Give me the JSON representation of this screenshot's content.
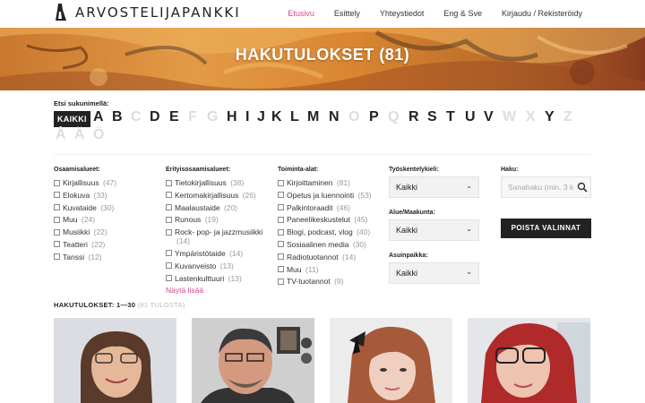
{
  "header": {
    "logo_text": "ARVOSTELIJAPANKKI",
    "nav": [
      {
        "label": "Etusivu",
        "active": true
      },
      {
        "label": "Esittely",
        "active": false
      },
      {
        "label": "Yhteystiedot",
        "active": false
      },
      {
        "label": "Eng & Sve",
        "active": false
      },
      {
        "label": "Kirjaudu / Rekisteröidy",
        "active": false
      }
    ]
  },
  "banner": {
    "title": "HAKUTULOKSET (81)"
  },
  "alphabet": {
    "label": "Etsi sukunimellä:",
    "all_label": "KAIKKI",
    "letters": [
      {
        "l": "A",
        "on": true
      },
      {
        "l": "B",
        "on": true
      },
      {
        "l": "C",
        "on": false
      },
      {
        "l": "D",
        "on": true
      },
      {
        "l": "E",
        "on": true
      },
      {
        "l": "F",
        "on": false
      },
      {
        "l": "G",
        "on": false
      },
      {
        "l": "H",
        "on": true
      },
      {
        "l": "I",
        "on": true
      },
      {
        "l": "J",
        "on": true
      },
      {
        "l": "K",
        "on": true
      },
      {
        "l": "L",
        "on": true
      },
      {
        "l": "M",
        "on": true
      },
      {
        "l": "N",
        "on": true
      },
      {
        "l": "O",
        "on": false
      },
      {
        "l": "P",
        "on": true
      },
      {
        "l": "Q",
        "on": false
      },
      {
        "l": "R",
        "on": true
      },
      {
        "l": "S",
        "on": true
      },
      {
        "l": "T",
        "on": true
      },
      {
        "l": "U",
        "on": true
      },
      {
        "l": "V",
        "on": true
      },
      {
        "l": "W",
        "on": false
      },
      {
        "l": "X",
        "on": false
      },
      {
        "l": "Y",
        "on": true
      },
      {
        "l": "Z",
        "on": false
      },
      {
        "l": "Å",
        "on": false
      },
      {
        "l": "Ä",
        "on": false
      },
      {
        "l": "Ö",
        "on": false
      }
    ]
  },
  "filters": {
    "osaamisalueet": {
      "title": "Osaamisalueet:",
      "items": [
        {
          "label": "Kirjallisuus",
          "count": "(47)"
        },
        {
          "label": "Elokuva",
          "count": "(33)"
        },
        {
          "label": "Kuvataide",
          "count": "(30)"
        },
        {
          "label": "Muu",
          "count": "(24)"
        },
        {
          "label": "Musiikki",
          "count": "(22)"
        },
        {
          "label": "Teatteri",
          "count": "(22)"
        },
        {
          "label": "Tanssi",
          "count": "(12)"
        }
      ]
    },
    "erityisosaamisalueet": {
      "title": "Erityisosaamisalueet:",
      "items": [
        {
          "label": "Tietokirjallisuus",
          "count": "(38)"
        },
        {
          "label": "Kertomakirjallisuus",
          "count": "(26)"
        },
        {
          "label": "Maalaustaide",
          "count": "(20)"
        },
        {
          "label": "Runous",
          "count": "(19)"
        },
        {
          "label": "Rock- pop- ja jazzmusiikki",
          "count": "(14)"
        },
        {
          "label": "Ympäristötaide",
          "count": "(14)"
        },
        {
          "label": "Kuvanveisto",
          "count": "(13)"
        },
        {
          "label": "Lastenkulttuuri",
          "count": "(13)"
        }
      ],
      "more": "Näytä lisää"
    },
    "toiminta": {
      "title": "Toiminta-alat:",
      "items": [
        {
          "label": "Kirjoittaminen",
          "count": "(81)"
        },
        {
          "label": "Opetus ja luennointi",
          "count": "(53)"
        },
        {
          "label": "Palkintoraadit",
          "count": "(46)"
        },
        {
          "label": "Paneelikeskustelut",
          "count": "(45)"
        },
        {
          "label": "Blogi, podcast, vlog",
          "count": "(40)"
        },
        {
          "label": "Sosiaalinen media",
          "count": "(30)"
        },
        {
          "label": "Radiotuotannot",
          "count": "(14)"
        },
        {
          "label": "Muu",
          "count": "(11)"
        },
        {
          "label": "TV-tuotannot",
          "count": "(9)"
        }
      ]
    },
    "selects": [
      {
        "label": "Työskentelykieli:",
        "value": "Kaikki"
      },
      {
        "label": "Alue/Maakunta:",
        "value": "Kaikki"
      },
      {
        "label": "Asuinpaikka:",
        "value": "Kaikki"
      }
    ],
    "search": {
      "label": "Haku:",
      "placeholder": "Sanahaku (min. 3 k"
    },
    "clear_label": "POISTA VALINNAT"
  },
  "results": {
    "label": "HAKUTULOKSET: 1—30",
    "sub": "(81 TULOSTA)"
  },
  "colors": {
    "accent": "#d04a8a",
    "dark": "#222222",
    "banner": "#d98a3a"
  }
}
